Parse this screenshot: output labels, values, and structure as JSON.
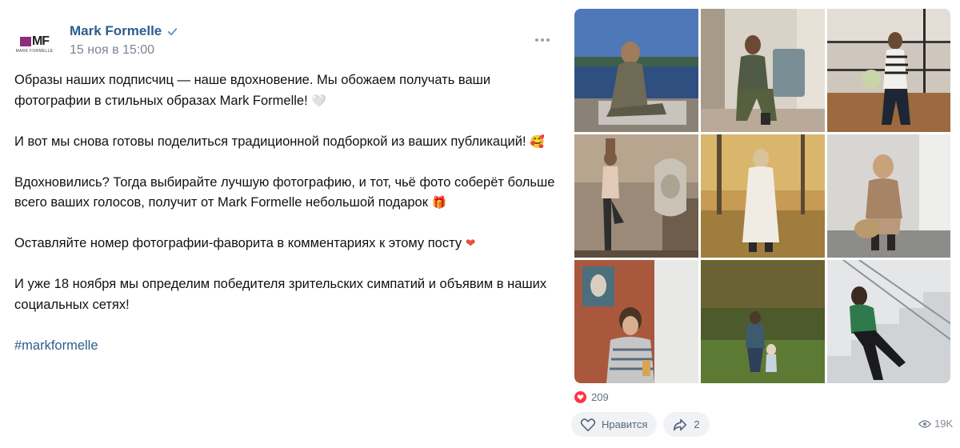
{
  "post": {
    "author": "Mark Formelle",
    "date": "15 ноя в 15:00",
    "logo": {
      "text": "MF",
      "subtext": "MARK FORMELLE",
      "accent": "#8e2d7b"
    },
    "verified_icon": "verified-check-icon",
    "more_icon": "more-dots-icon",
    "paragraphs": [
      {
        "text": "Образы наших подписчиц — наше вдохновение. Мы обожаем получать ваши фотографии в стильных образах Mark Formelle!",
        "emoji": "🤍"
      },
      {
        "text": "И вот мы снова готовы поделиться традиционной подборкой из ваших публикаций!",
        "emoji": "🥰"
      },
      {
        "text": "Вдохновились? Тогда выбирайте лучшую фотографию, и тот, чьё фото соберёт больше всего ваших голосов, получит от Mark Formelle небольшой подарок",
        "emoji": "🎁"
      },
      {
        "text": "Оставляйте номер фотографии-фаворита в комментариях к этому посту",
        "emoji": "❤"
      },
      {
        "text": "И уже 18 ноября мы определим победителя зрительских симпатий и объявим в наших социальных сетях!",
        "emoji": ""
      }
    ],
    "hashtag": "#markformelle"
  },
  "photos": [
    {
      "name": "photo-1"
    },
    {
      "name": "photo-2"
    },
    {
      "name": "photo-3"
    },
    {
      "name": "photo-4"
    },
    {
      "name": "photo-5"
    },
    {
      "name": "photo-6"
    },
    {
      "name": "photo-7"
    },
    {
      "name": "photo-8"
    },
    {
      "name": "photo-9"
    }
  ],
  "footer": {
    "likes_count": "209",
    "like_label": "Нравится",
    "share_count": "2",
    "views": "19K"
  },
  "colors": {
    "link": "#2c5d8f",
    "date": "#7a8593",
    "heart": "#ff3347",
    "button_bg": "#f0f2f5"
  }
}
